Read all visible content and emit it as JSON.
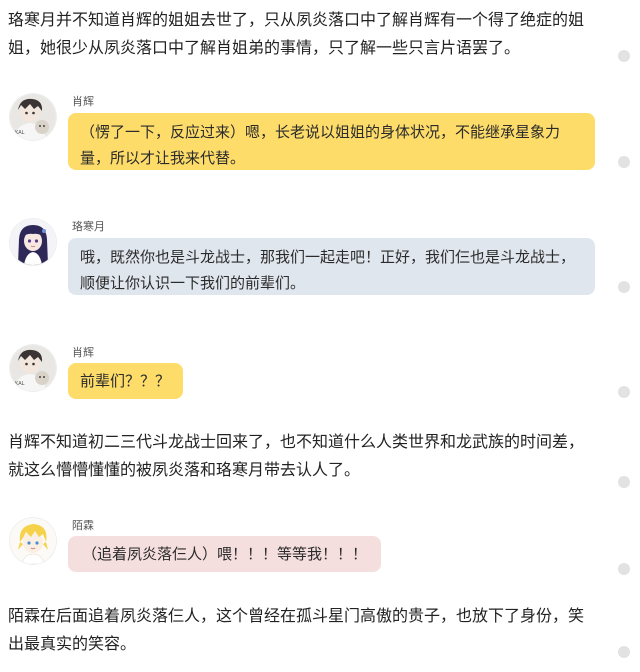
{
  "paragraphs": [
    "珞寒月并不知道肖辉的姐姐去世了，只从夙炎落口中了解肖辉有一个得了绝症的姐姐，她很少从夙炎落口中了解肖姐弟的事情，只了解一些只言片语罢了。",
    "肖辉不知道初二三代斗龙战士回来了，也不知道什么人类世界和龙武族的时间差，就这么懵懵懂懂的被夙炎落和珞寒月带去认人了。",
    "陌霖在后面追着夙炎落仨人，这个曾经在孤斗星门高傲的贵子，也放下了身份，笑出最真实的笑容。"
  ],
  "messages": [
    {
      "speaker": "肖辉",
      "text": "（愣了一下，反应过来）嗯，长老说以姐姐的身体状况，不能继承星象力量，所以才让我来代替。",
      "bubble_color": "#fddc6a"
    },
    {
      "speaker": "珞寒月",
      "text": "哦，既然你也是斗龙战士，那我们一起走吧！正好，我们仨也是斗龙战士，顺便让你认识一下我们的前辈们。",
      "bubble_color": "#e0e6ee"
    },
    {
      "speaker": "肖辉",
      "text": "前辈们？？？",
      "bubble_color": "#fddc6a"
    },
    {
      "speaker": "陌霖",
      "text": "（追着夙炎落仨人）喂！！！等等我！！！",
      "bubble_color": "#f5dede"
    }
  ],
  "avatars": {
    "xiaohui": "boy-with-dark-hair-holding-plush-icon",
    "luohanyue": "girl-with-dark-purple-hair-icon",
    "molin": "boy-with-blonde-hair-icon"
  }
}
